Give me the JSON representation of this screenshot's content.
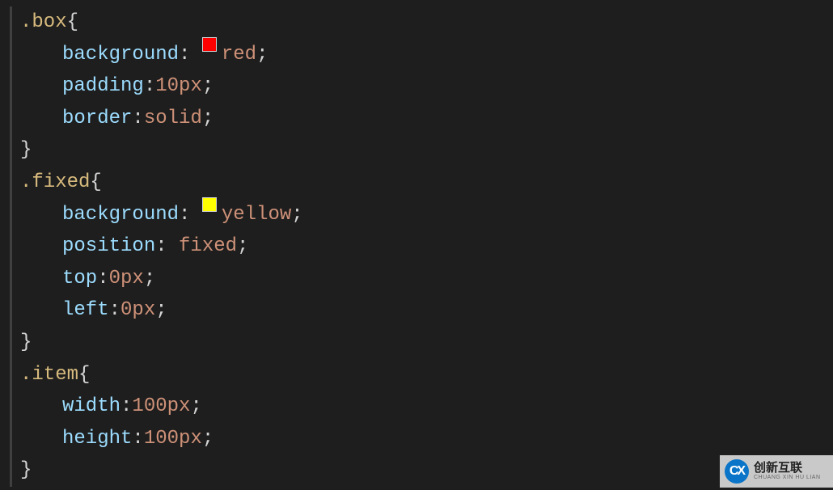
{
  "code": {
    "selector_box": ".box",
    "selector_fixed": ".fixed",
    "selector_item": ".item",
    "lbrace": "{",
    "rbrace": "}",
    "colon": ":",
    "semicolon": ";",
    "space": " ",
    "prop_background": "background",
    "prop_padding": "padding",
    "prop_border": "border",
    "prop_position": "position",
    "prop_top": "top",
    "prop_left": "left",
    "prop_width": "width",
    "prop_height": "height",
    "val_red": "red",
    "val_yellow": "yellow",
    "val_10px": "10px",
    "val_solid": "solid",
    "val_fixed": "fixed",
    "val_0px": "0px",
    "val_100px": "100px",
    "swatch_red": "#ff0000",
    "swatch_yellow": "#ffff00"
  },
  "watermark": {
    "logo_text": "CX",
    "cn": "创新互联",
    "py": "CHUANG XIN HU LIAN"
  }
}
